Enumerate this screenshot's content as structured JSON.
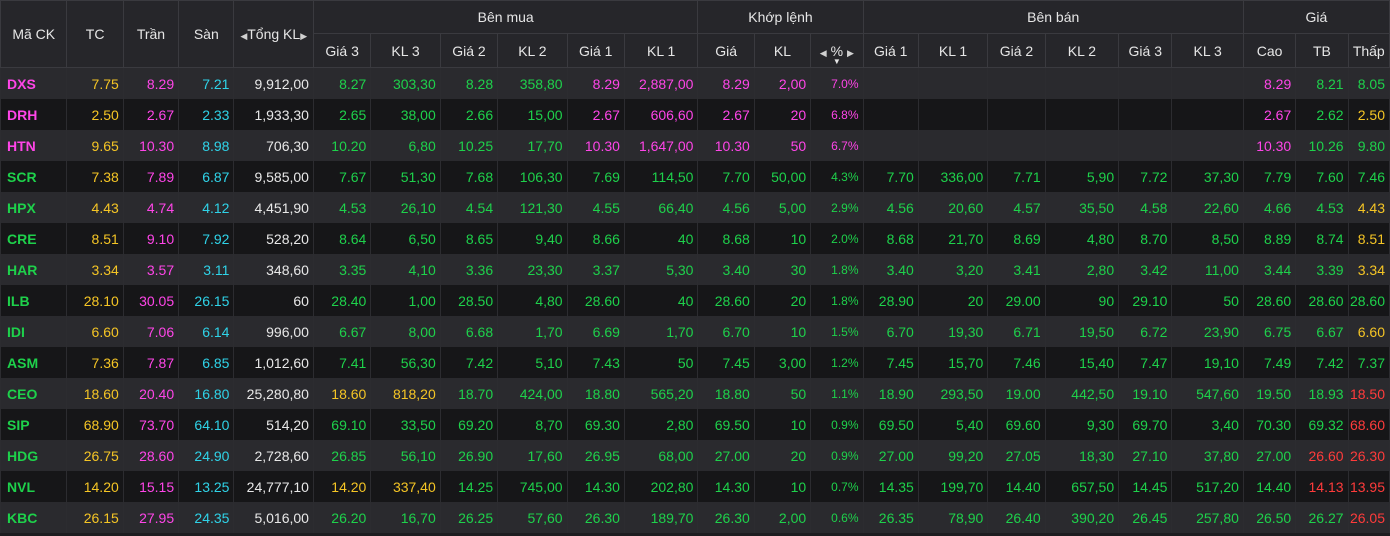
{
  "header": {
    "symbol": "Mã CK",
    "ref": "TC",
    "ceiling": "Trần",
    "floor": "Sàn",
    "total_vol": "Tổng KL",
    "buy_group": "Bên mua",
    "match_group": "Khớp lệnh",
    "sell_group": "Bên bán",
    "price_group": "Giá",
    "buy_cols": [
      "Giá 3",
      "KL 3",
      "Giá 2",
      "KL 2",
      "Giá 1",
      "KL 1"
    ],
    "match_cols": [
      "Giá",
      "KL",
      "%"
    ],
    "sell_cols": [
      "Giá 1",
      "KL 1",
      "Giá 2",
      "KL 2",
      "Giá 3",
      "KL 3"
    ],
    "price_cols": [
      "Cao",
      "TB",
      "Thấp"
    ]
  },
  "colors": {
    "up": "#1ed14b",
    "ceiling": "#ff45e8",
    "floor": "#2fd3e8",
    "reference": "#f5c525",
    "down": "#ff3b3b"
  },
  "rows": [
    {
      "symbol": "DXS",
      "tc": "7.75",
      "tran": "8.29",
      "san": "7.21",
      "tong": "9,912,00",
      "b3": "8.27",
      "bk3": "303,30",
      "b2": "8.28",
      "bk2": "358,80",
      "b1": "8.29",
      "bk1": "2,887,00",
      "mp": "8.29",
      "mk": "2,00",
      "pct": "7.0%",
      "s1": "",
      "sk1": "",
      "s2": "",
      "sk2": "",
      "s3": "",
      "sk3": "",
      "hi": "8.29",
      "avg": "8.21",
      "lo": "8.05"
    },
    {
      "symbol": "DRH",
      "tc": "2.50",
      "tran": "2.67",
      "san": "2.33",
      "tong": "1,933,30",
      "b3": "2.65",
      "bk3": "38,00",
      "b2": "2.66",
      "bk2": "15,00",
      "b1": "2.67",
      "bk1": "606,60",
      "mp": "2.67",
      "mk": "20",
      "pct": "6.8%",
      "s1": "",
      "sk1": "",
      "s2": "",
      "sk2": "",
      "s3": "",
      "sk3": "",
      "hi": "2.67",
      "avg": "2.62",
      "lo": "2.50"
    },
    {
      "symbol": "HTN",
      "tc": "9.65",
      "tran": "10.30",
      "san": "8.98",
      "tong": "706,30",
      "b3": "10.20",
      "bk3": "6,80",
      "b2": "10.25",
      "bk2": "17,70",
      "b1": "10.30",
      "bk1": "1,647,00",
      "mp": "10.30",
      "mk": "50",
      "pct": "6.7%",
      "s1": "",
      "sk1": "",
      "s2": "",
      "sk2": "",
      "s3": "",
      "sk3": "",
      "hi": "10.30",
      "avg": "10.26",
      "lo": "9.80"
    },
    {
      "symbol": "SCR",
      "tc": "7.38",
      "tran": "7.89",
      "san": "6.87",
      "tong": "9,585,00",
      "b3": "7.67",
      "bk3": "51,30",
      "b2": "7.68",
      "bk2": "106,30",
      "b1": "7.69",
      "bk1": "114,50",
      "mp": "7.70",
      "mk": "50,00",
      "pct": "4.3%",
      "s1": "7.70",
      "sk1": "336,00",
      "s2": "7.71",
      "sk2": "5,90",
      "s3": "7.72",
      "sk3": "37,30",
      "hi": "7.79",
      "avg": "7.60",
      "lo": "7.46"
    },
    {
      "symbol": "HPX",
      "tc": "4.43",
      "tran": "4.74",
      "san": "4.12",
      "tong": "4,451,90",
      "b3": "4.53",
      "bk3": "26,10",
      "b2": "4.54",
      "bk2": "121,30",
      "b1": "4.55",
      "bk1": "66,40",
      "mp": "4.56",
      "mk": "5,00",
      "pct": "2.9%",
      "s1": "4.56",
      "sk1": "20,60",
      "s2": "4.57",
      "sk2": "35,50",
      "s3": "4.58",
      "sk3": "22,60",
      "hi": "4.66",
      "avg": "4.53",
      "lo": "4.43"
    },
    {
      "symbol": "CRE",
      "tc": "8.51",
      "tran": "9.10",
      "san": "7.92",
      "tong": "528,20",
      "b3": "8.64",
      "bk3": "6,50",
      "b2": "8.65",
      "bk2": "9,40",
      "b1": "8.66",
      "bk1": "40",
      "mp": "8.68",
      "mk": "10",
      "pct": "2.0%",
      "s1": "8.68",
      "sk1": "21,70",
      "s2": "8.69",
      "sk2": "4,80",
      "s3": "8.70",
      "sk3": "8,50",
      "hi": "8.89",
      "avg": "8.74",
      "lo": "8.51"
    },
    {
      "symbol": "HAR",
      "tc": "3.34",
      "tran": "3.57",
      "san": "3.11",
      "tong": "348,60",
      "b3": "3.35",
      "bk3": "4,10",
      "b2": "3.36",
      "bk2": "23,30",
      "b1": "3.37",
      "bk1": "5,30",
      "mp": "3.40",
      "mk": "30",
      "pct": "1.8%",
      "s1": "3.40",
      "sk1": "3,20",
      "s2": "3.41",
      "sk2": "2,80",
      "s3": "3.42",
      "sk3": "11,00",
      "hi": "3.44",
      "avg": "3.39",
      "lo": "3.34"
    },
    {
      "symbol": "ILB",
      "tc": "28.10",
      "tran": "30.05",
      "san": "26.15",
      "tong": "60",
      "b3": "28.40",
      "bk3": "1,00",
      "b2": "28.50",
      "bk2": "4,80",
      "b1": "28.60",
      "bk1": "40",
      "mp": "28.60",
      "mk": "20",
      "pct": "1.8%",
      "s1": "28.90",
      "sk1": "20",
      "s2": "29.00",
      "sk2": "90",
      "s3": "29.10",
      "sk3": "50",
      "hi": "28.60",
      "avg": "28.60",
      "lo": "28.60"
    },
    {
      "symbol": "IDI",
      "tc": "6.60",
      "tran": "7.06",
      "san": "6.14",
      "tong": "996,00",
      "b3": "6.67",
      "bk3": "8,00",
      "b2": "6.68",
      "bk2": "1,70",
      "b1": "6.69",
      "bk1": "1,70",
      "mp": "6.70",
      "mk": "10",
      "pct": "1.5%",
      "s1": "6.70",
      "sk1": "19,30",
      "s2": "6.71",
      "sk2": "19,50",
      "s3": "6.72",
      "sk3": "23,90",
      "hi": "6.75",
      "avg": "6.67",
      "lo": "6.60"
    },
    {
      "symbol": "ASM",
      "tc": "7.36",
      "tran": "7.87",
      "san": "6.85",
      "tong": "1,012,60",
      "b3": "7.41",
      "bk3": "56,30",
      "b2": "7.42",
      "bk2": "5,10",
      "b1": "7.43",
      "bk1": "50",
      "mp": "7.45",
      "mk": "3,00",
      "pct": "1.2%",
      "s1": "7.45",
      "sk1": "15,70",
      "s2": "7.46",
      "sk2": "15,40",
      "s3": "7.47",
      "sk3": "19,10",
      "hi": "7.49",
      "avg": "7.42",
      "lo": "7.37"
    },
    {
      "symbol": "CEO",
      "tc": "18.60",
      "tran": "20.40",
      "san": "16.80",
      "tong": "25,280,80",
      "b3": "18.60",
      "bk3": "818,20",
      "b2": "18.70",
      "bk2": "424,00",
      "b1": "18.80",
      "bk1": "565,20",
      "mp": "18.80",
      "mk": "50",
      "pct": "1.1%",
      "s1": "18.90",
      "sk1": "293,50",
      "s2": "19.00",
      "sk2": "442,50",
      "s3": "19.10",
      "sk3": "547,60",
      "hi": "19.50",
      "avg": "18.93",
      "lo": "18.50"
    },
    {
      "symbol": "SIP",
      "tc": "68.90",
      "tran": "73.70",
      "san": "64.10",
      "tong": "514,20",
      "b3": "69.10",
      "bk3": "33,50",
      "b2": "69.20",
      "bk2": "8,70",
      "b1": "69.30",
      "bk1": "2,80",
      "mp": "69.50",
      "mk": "10",
      "pct": "0.9%",
      "s1": "69.50",
      "sk1": "5,40",
      "s2": "69.60",
      "sk2": "9,30",
      "s3": "69.70",
      "sk3": "3,40",
      "hi": "70.30",
      "avg": "69.32",
      "lo": "68.60"
    },
    {
      "symbol": "HDG",
      "tc": "26.75",
      "tran": "28.60",
      "san": "24.90",
      "tong": "2,728,60",
      "b3": "26.85",
      "bk3": "56,10",
      "b2": "26.90",
      "bk2": "17,60",
      "b1": "26.95",
      "bk1": "68,00",
      "mp": "27.00",
      "mk": "20",
      "pct": "0.9%",
      "s1": "27.00",
      "sk1": "99,20",
      "s2": "27.05",
      "sk2": "18,30",
      "s3": "27.10",
      "sk3": "37,80",
      "hi": "27.00",
      "avg": "26.60",
      "lo": "26.30"
    },
    {
      "symbol": "NVL",
      "tc": "14.20",
      "tran": "15.15",
      "san": "13.25",
      "tong": "24,777,10",
      "b3": "14.20",
      "bk3": "337,40",
      "b2": "14.25",
      "bk2": "745,00",
      "b1": "14.30",
      "bk1": "202,80",
      "mp": "14.30",
      "mk": "10",
      "pct": "0.7%",
      "s1": "14.35",
      "sk1": "199,70",
      "s2": "14.40",
      "sk2": "657,50",
      "s3": "14.45",
      "sk3": "517,20",
      "hi": "14.40",
      "avg": "14.13",
      "lo": "13.95"
    },
    {
      "symbol": "KBC",
      "tc": "26.15",
      "tran": "27.95",
      "san": "24.35",
      "tong": "5,016,00",
      "b3": "26.20",
      "bk3": "16,70",
      "b2": "26.25",
      "bk2": "57,60",
      "b1": "26.30",
      "bk1": "189,70",
      "mp": "26.30",
      "mk": "2,00",
      "pct": "0.6%",
      "s1": "26.35",
      "sk1": "78,90",
      "s2": "26.40",
      "sk2": "390,20",
      "s3": "26.45",
      "sk3": "257,80",
      "hi": "26.50",
      "avg": "26.27",
      "lo": "26.05"
    }
  ]
}
